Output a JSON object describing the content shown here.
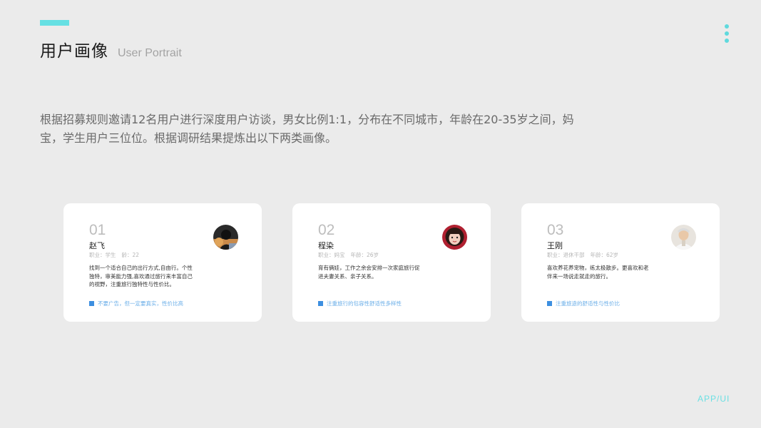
{
  "header": {
    "title_cn": "用户画像",
    "title_en": "User Portrait"
  },
  "intro": "根据招募规则邀请12名用户进行深度用户访谈，男女比例1:1，分布在不同城市，年龄在20-35岁之间，妈宝，学生用户三位位。根据调研结果提炼出以下两类画像。",
  "cards": [
    {
      "number": "01",
      "name": "赵飞",
      "job": "职业：学生",
      "age": "龄：22",
      "description": "找到一个适合自己的出行方式,自由行。个性独特，审美能力强,喜欢通过旅行来丰富自己的视野，注重旅行独特性与性价比。",
      "tag": "不要广告，但一定要真实，性价比高",
      "avatar_icon": "male-student-avatar-icon"
    },
    {
      "number": "02",
      "name": "程染",
      "job": "职业：妈宝",
      "age": "年龄：26岁",
      "description": "育有俩娃，工作之余会安排一次家庭旅行促进夫妻关系、亲子关系。",
      "tag": "注重旅行的包容性舒适性多样性",
      "avatar_icon": "young-mother-avatar-icon"
    },
    {
      "number": "03",
      "name": "王刚",
      "job": "职业：退休干部",
      "age": "年龄：62岁",
      "description": "喜欢养花养宠物，练太极散步。更喜欢和老伴来一场说走就走的旅行。",
      "tag": "注重旅途的舒适性与性价比",
      "avatar_icon": "elderly-man-avatar-icon"
    }
  ],
  "footer": {
    "label": "APP/UI"
  },
  "colors": {
    "background": "#ebebeb",
    "accent_cyan": "#66e0e3",
    "tag_blue": "#3d8fe0",
    "tag_text": "#6aaee8"
  }
}
